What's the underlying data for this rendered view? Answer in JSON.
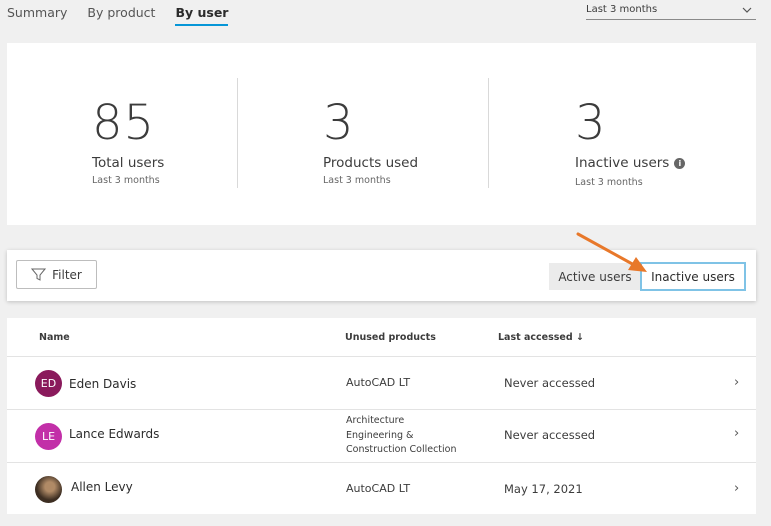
{
  "tabs": [
    {
      "label": "Summary",
      "active": false
    },
    {
      "label": "By product",
      "active": false
    },
    {
      "label": "By user",
      "active": true
    }
  ],
  "range_select": {
    "value": "Last 3 months"
  },
  "stats": [
    {
      "number": "85",
      "label": "Total users",
      "sub": "Last 3 months"
    },
    {
      "number": "3",
      "label": "Products used",
      "sub": "Last 3 months"
    },
    {
      "number": "3",
      "label": "Inactive users",
      "sub": "Last 3 months",
      "info_icon": "info-icon"
    }
  ],
  "filterbar": {
    "filter_label": "Filter",
    "filter_icon": "funnel-icon",
    "active_users_label": "Active users",
    "inactive_users_label": "Inactive users",
    "selected": "Inactive users"
  },
  "table": {
    "columns": [
      "Name",
      "Unused products",
      "Last accessed ↓"
    ],
    "rows": [
      {
        "initials": "ED",
        "avatar_color": "#8a1a5c",
        "name": "Eden Davis",
        "products": [
          "AutoCAD LT"
        ],
        "last_accessed": "Never accessed"
      },
      {
        "initials": "LE",
        "avatar_color": "#c22fa8",
        "name": "Lance Edwards",
        "products": [
          "Architecture",
          "Engineering &",
          "Construction Collection"
        ],
        "last_accessed": "Never accessed"
      },
      {
        "initials": "",
        "avatar_color": "#4a3a2a",
        "name": "Allen Levy",
        "products": [
          "AutoCAD LT"
        ],
        "last_accessed": "May 17, 2021"
      }
    ]
  },
  "colors": {
    "accent": "#0696d7",
    "annotation_arrow": "#e8782a",
    "selected_border": "#7fc3e6"
  }
}
